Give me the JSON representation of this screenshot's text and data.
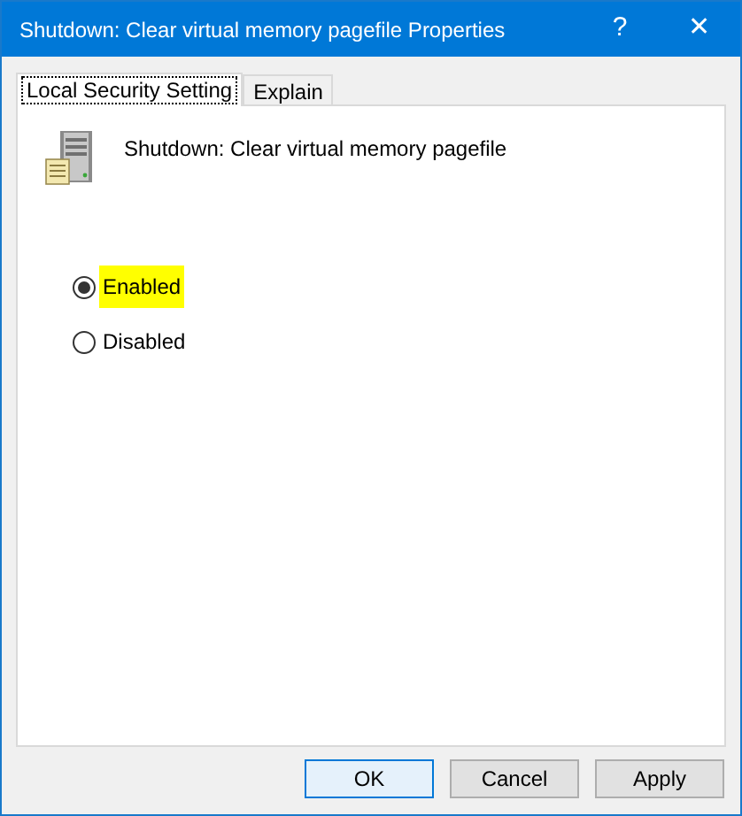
{
  "window": {
    "title": "Shutdown: Clear virtual memory pagefile Properties",
    "help": "?",
    "close": "✕"
  },
  "tabs": [
    {
      "label": "Local Security Setting",
      "selected": true
    },
    {
      "label": "Explain",
      "selected": false
    }
  ],
  "policy_name": "Shutdown: Clear virtual memory pagefile",
  "options": [
    {
      "label": "Enabled",
      "selected": true,
      "highlighted": true
    },
    {
      "label": "Disabled",
      "selected": false,
      "highlighted": false
    }
  ],
  "buttons": [
    {
      "label": "OK",
      "default": true
    },
    {
      "label": "Cancel",
      "default": false
    },
    {
      "label": "Apply",
      "default": false
    }
  ]
}
